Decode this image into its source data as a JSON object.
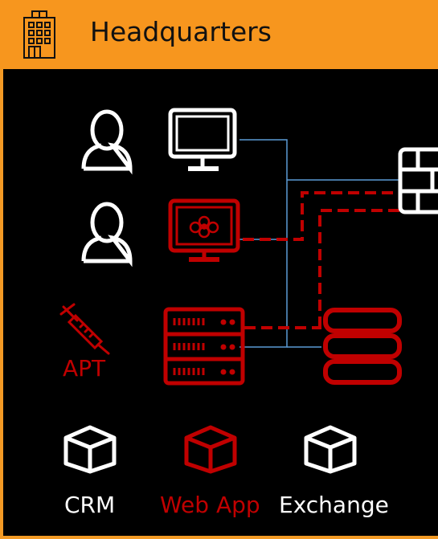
{
  "header": {
    "title": "Headquarters",
    "icon": "building-icon"
  },
  "labels": {
    "apt": "APT",
    "crm": "CRM",
    "web_app": "Web App",
    "exchange": "Exchange"
  },
  "colors": {
    "header_bg": "#F7961E",
    "border": "#F39A25",
    "background": "#000000",
    "white": "#FFFFFF",
    "threat_red": "#C00000",
    "link_blue": "#5B9BD5"
  },
  "nodes": [
    {
      "icon": "user-icon",
      "state": "normal"
    },
    {
      "icon": "user-icon",
      "state": "normal"
    },
    {
      "icon": "monitor-icon",
      "state": "normal"
    },
    {
      "icon": "infected-monitor-icon",
      "state": "compromised"
    },
    {
      "icon": "syringe-icon",
      "state": "threat"
    },
    {
      "icon": "server-rack-icon",
      "state": "compromised"
    },
    {
      "icon": "database-icon",
      "state": "compromised"
    },
    {
      "icon": "firewall-icon",
      "state": "normal"
    },
    {
      "icon": "crm-app-icon",
      "state": "normal"
    },
    {
      "icon": "web-app-icon",
      "state": "compromised"
    },
    {
      "icon": "exchange-app-icon",
      "state": "normal"
    }
  ]
}
